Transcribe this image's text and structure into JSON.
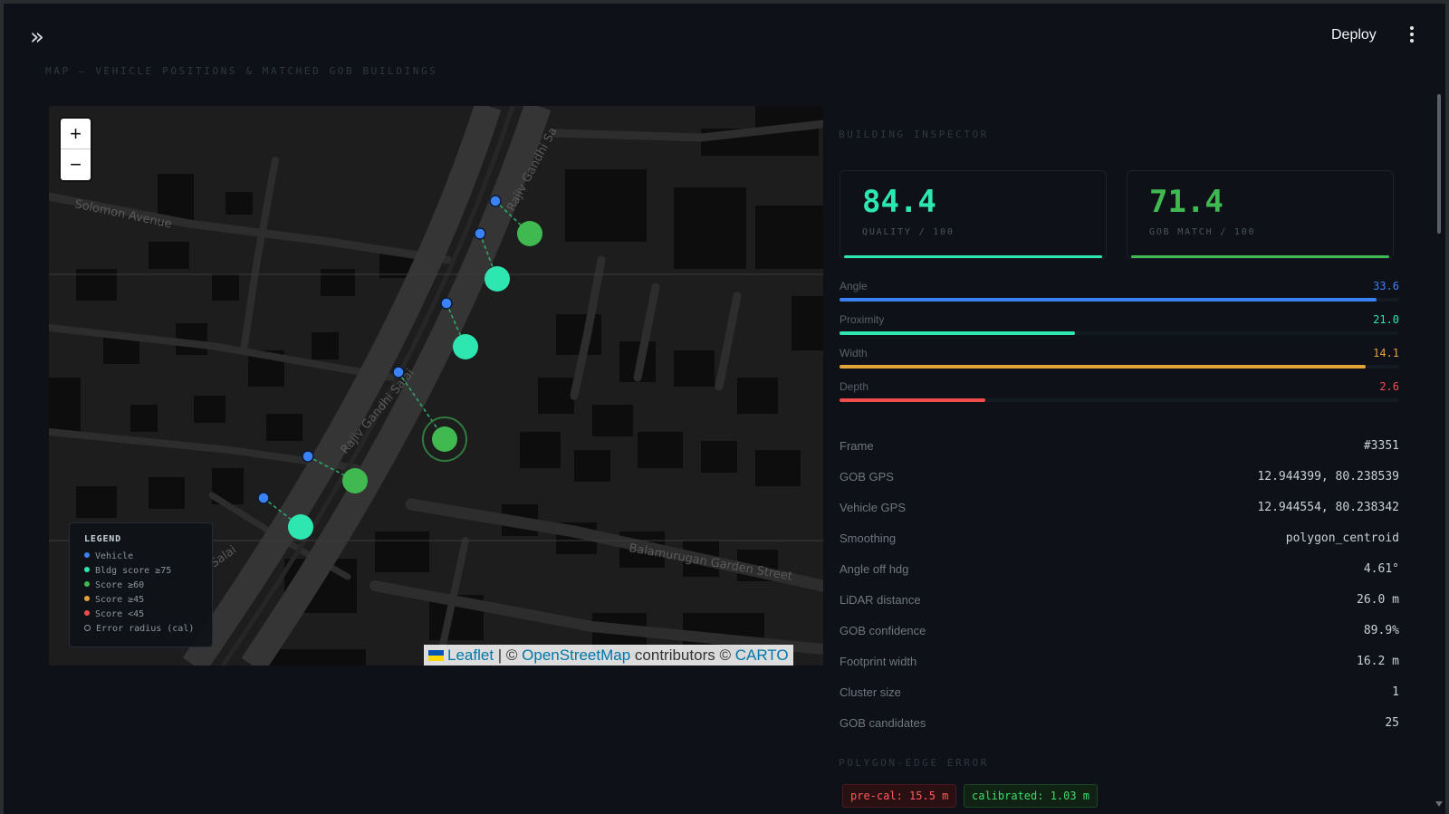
{
  "topbar": {
    "deploy_label": "Deploy"
  },
  "map_section": {
    "title": "MAP — VEHICLE POSITIONS & MATCHED GOB BUILDINGS",
    "street_labels": [
      "Solomon Avenue",
      "Rajiv Gandhi Sa",
      "Rajiv Gandhi Salai",
      "Salai",
      "Balamurugan Garden Street"
    ],
    "zoom_in": "+",
    "zoom_out": "−",
    "legend": {
      "title": "LEGEND",
      "items": [
        {
          "label": "Vehicle",
          "color": "#3b82f6"
        },
        {
          "label": "Bldg score ≥75",
          "color": "#2ee6b0"
        },
        {
          "label": "Score ≥60",
          "color": "#3fb950"
        },
        {
          "label": "Score ≥45",
          "color": "#e3a33b"
        },
        {
          "label": "Score <45",
          "color": "#f04c4c"
        },
        {
          "label": "Error radius (cal)",
          "color": "transparent"
        }
      ]
    },
    "attribution": {
      "leaflet": "Leaflet",
      "sep": " | © ",
      "osm": "OpenStreetMap",
      "contrib": " contributors © ",
      "carto": "CARTO"
    }
  },
  "inspector": {
    "title": "BUILDING INSPECTOR",
    "cards": [
      {
        "value": "84.4",
        "caption": "QUALITY / 100",
        "color": "#2ee6b0"
      },
      {
        "value": "71.4",
        "caption": "GOB MATCH / 100",
        "color": "#3fb950"
      }
    ],
    "metrics": [
      {
        "label": "Angle",
        "value": "33.6",
        "fraction": 0.96,
        "color": "#3b82f6"
      },
      {
        "label": "Proximity",
        "value": "21.0",
        "fraction": 0.42,
        "color": "#2ee6b0"
      },
      {
        "label": "Width",
        "value": "14.1",
        "fraction": 0.94,
        "color": "#e3a33b"
      },
      {
        "label": "Depth",
        "value": "2.6",
        "fraction": 0.26,
        "color": "#f04c4c"
      }
    ],
    "details": [
      {
        "key": "Frame",
        "value": "#3351"
      },
      {
        "key": "GOB GPS",
        "value": "12.944399, 80.238539"
      },
      {
        "key": "Vehicle GPS",
        "value": "12.944554, 80.238342"
      },
      {
        "key": "Smoothing",
        "value": "polygon_centroid"
      },
      {
        "key": "Angle off hdg",
        "value": "4.61°"
      },
      {
        "key": "LiDAR distance",
        "value": "26.0 m"
      },
      {
        "key": "GOB confidence",
        "value": "89.9%"
      },
      {
        "key": "Footprint width",
        "value": "16.2 m"
      },
      {
        "key": "Cluster size",
        "value": "1"
      },
      {
        "key": "GOB candidates",
        "value": "25"
      }
    ],
    "polygon_title": "POLYGON-EDGE ERROR",
    "pre_cal": "pre-cal: 15.5 m",
    "calibrated": "calibrated: 1.03 m"
  }
}
